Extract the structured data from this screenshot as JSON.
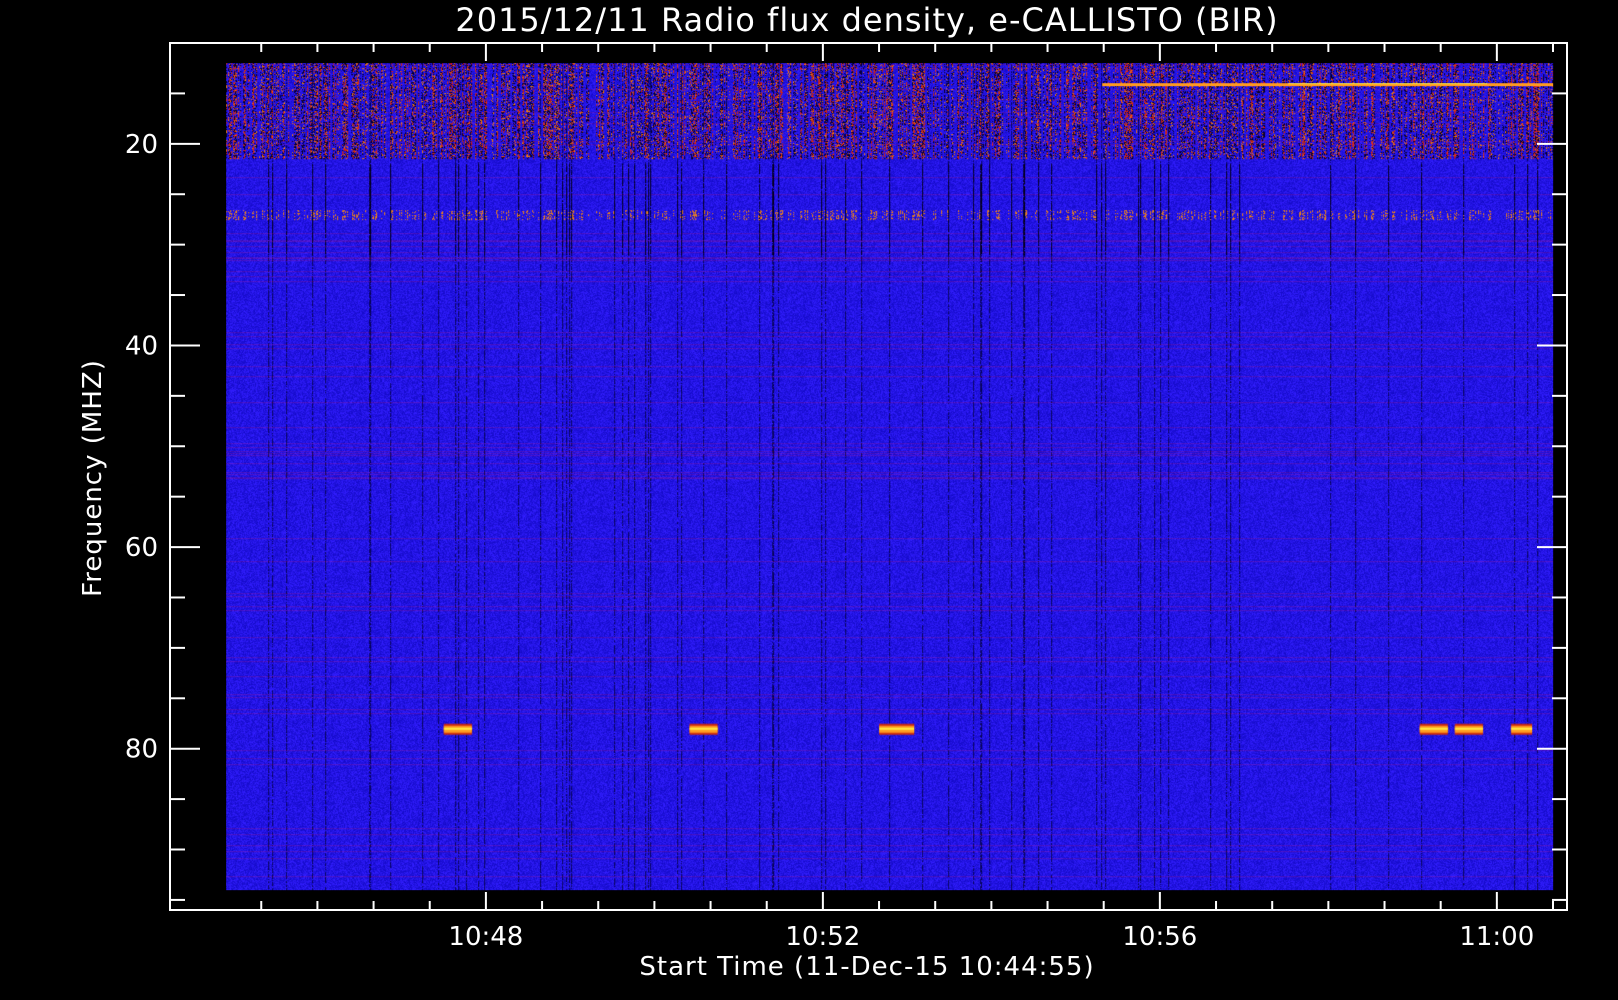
{
  "chart_data": {
    "type": "heatmap",
    "title": "2015/12/11  Radio flux density, e-CALLISTO (BIR)",
    "xlabel": "Start Time (11-Dec-15 10:44:55)",
    "ylabel": "Frequency (MHZ)",
    "x_start": "10:44:55",
    "x_end": "11:00:40",
    "x_axis_range": [
      "10:44:15",
      "11:00:50"
    ],
    "x_ticks": [
      "10:48",
      "10:52",
      "10:56",
      "11:00"
    ],
    "x_minor_step_minutes": 0.6667,
    "y_ticks": [
      20,
      40,
      60,
      80
    ],
    "y_axis_range": [
      10,
      96
    ],
    "y_data_range": [
      12,
      94
    ],
    "y_inverted": true,
    "colors": {
      "background": "#000000",
      "base": "#1a10f0",
      "dark": "#0a0560",
      "red": "#cc2a10",
      "orange": "#ff9a20",
      "yellow": "#ffee40"
    },
    "features": {
      "interference_bands_mhz": [
        14,
        18,
        20,
        27
      ],
      "persistent_band_mhz": 78,
      "persistent_band_segments": [
        [
          "10:47:30",
          "10:47:50"
        ],
        [
          "10:50:25",
          "10:50:45"
        ],
        [
          "10:52:40",
          "10:53:05"
        ],
        [
          "10:59:05",
          "10:59:25"
        ],
        [
          "10:59:30",
          "10:59:50"
        ],
        [
          "11:00:10",
          "11:00:25"
        ]
      ]
    }
  }
}
